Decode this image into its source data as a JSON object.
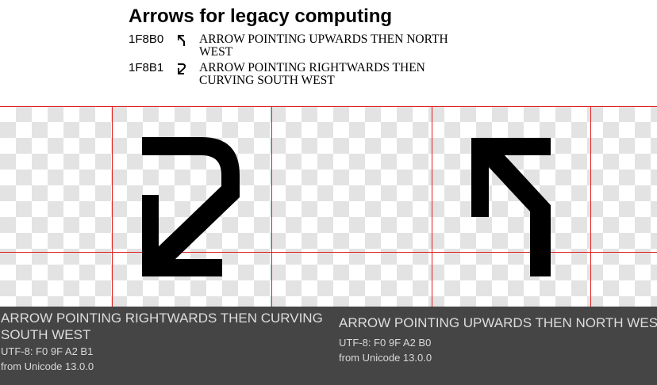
{
  "block_title": "Arrows for legacy computing",
  "entries": [
    {
      "code": "1F8B0",
      "glyph_icon": "arrow-up-then-northwest-icon",
      "name": "ARROW POINTING UPWARDS THEN NORTH WEST"
    },
    {
      "code": "1F8B1",
      "glyph_icon": "arrow-right-then-curving-southwest-icon",
      "name": "ARROW POINTING RIGHTWARDS THEN CURVING SOUTH WEST"
    }
  ],
  "preview": {
    "glyphs": [
      {
        "icon": "arrow-right-then-curving-southwest-icon"
      },
      {
        "icon": "arrow-up-then-northwest-icon"
      }
    ],
    "guide_color": "#e02020",
    "checker_color": "#e3e3e3"
  },
  "info": [
    {
      "name": "ARROW POINTING RIGHTWARDS THEN CURVING SOUTH WEST",
      "utf8": "UTF-8: F0 9F A2 B1",
      "version": "from Unicode 13.0.0"
    },
    {
      "name": "ARROW POINTING UPWARDS THEN NORTH WEST",
      "utf8": "UTF-8: F0 9F A2 B0",
      "version": "from Unicode 13.0.0"
    }
  ],
  "colors": {
    "panel_bg": "#454545",
    "panel_text": "#dddddd"
  }
}
